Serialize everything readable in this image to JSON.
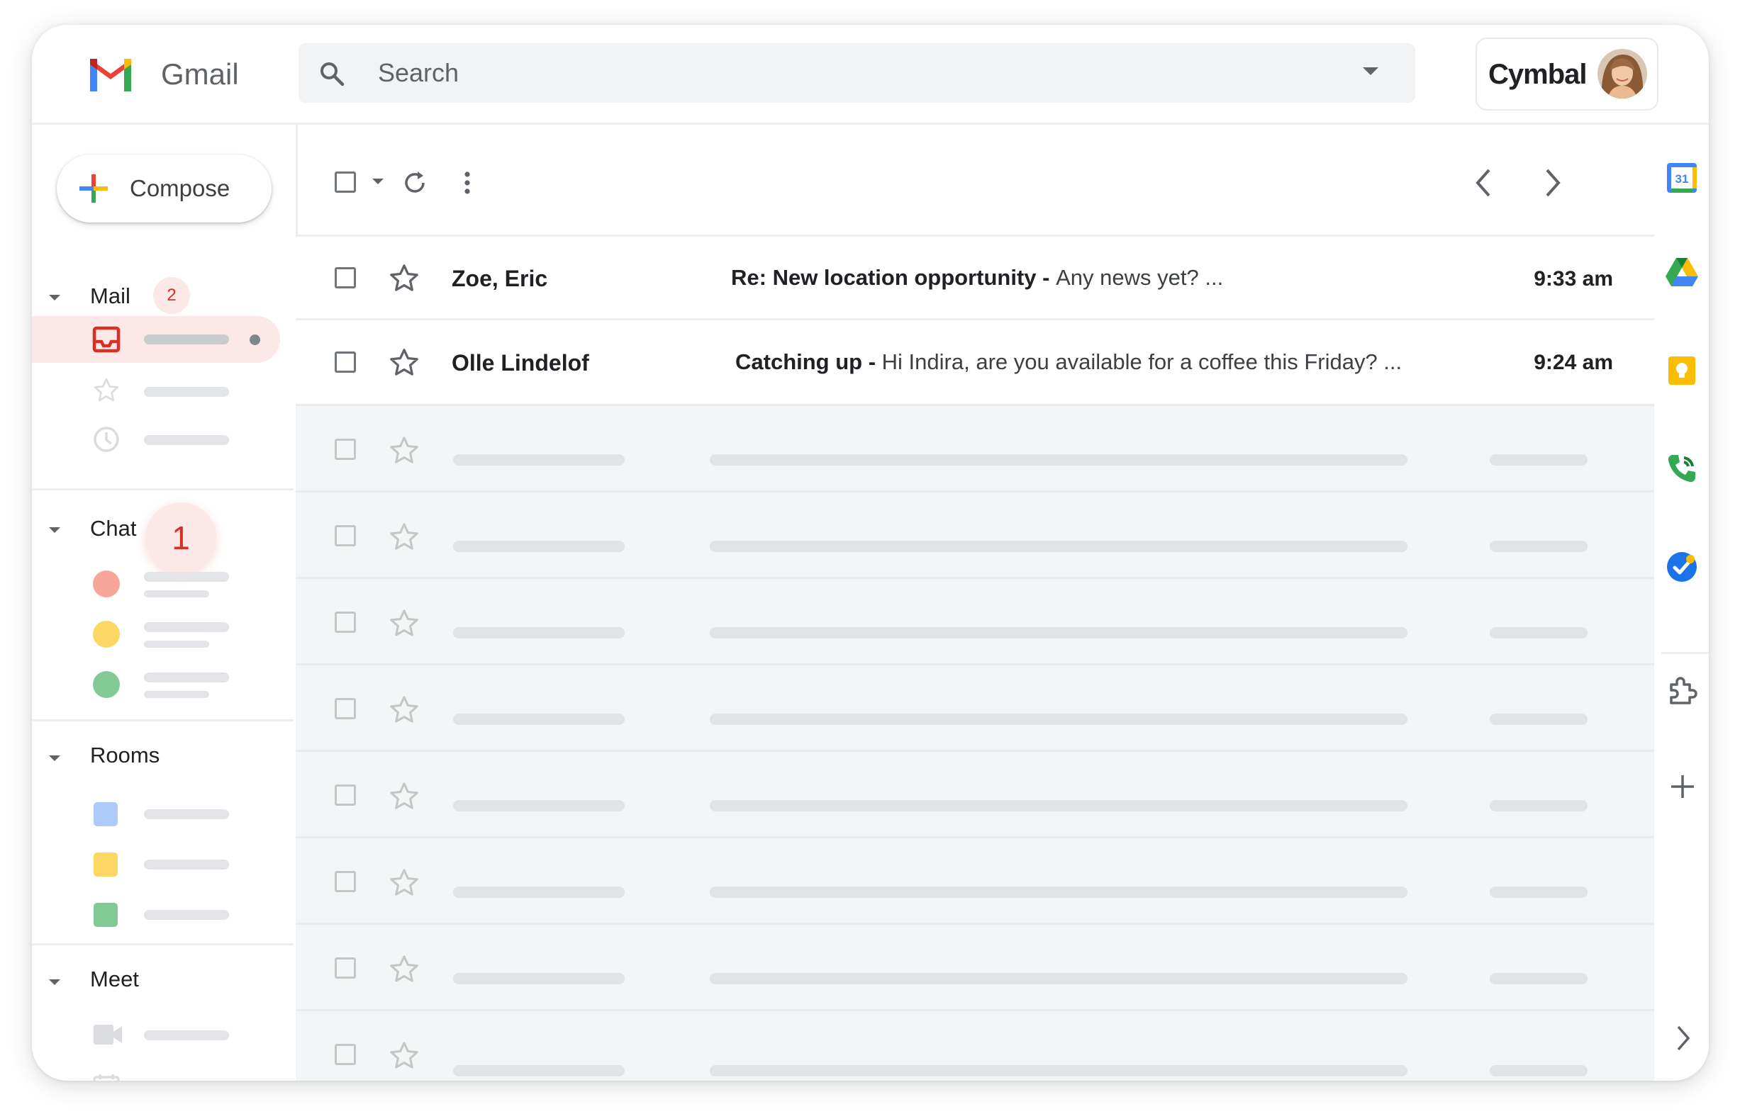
{
  "app": {
    "name": "Gmail",
    "brand": "Cymbal"
  },
  "search": {
    "placeholder": "Search"
  },
  "compose": {
    "label": "Compose"
  },
  "sections": {
    "mail": {
      "title": "Mail",
      "badge": "2"
    },
    "chat": {
      "title": "Chat",
      "badge": "1"
    },
    "rooms": {
      "title": "Rooms"
    },
    "meet": {
      "title": "Meet"
    }
  },
  "emails": [
    {
      "sender": "Zoe, Eric",
      "subject": "Re: New location opportunity",
      "separator": " - ",
      "snippet": "Any news yet? ...",
      "time": "9:33 am"
    },
    {
      "sender": "Olle Lindelof",
      "subject": "Catching up",
      "separator": " - ",
      "snippet": "Hi Indira, are you available for a coffee this Friday? ...",
      "time": "9:24 am"
    }
  ],
  "colors": {
    "accent_red": "#d93025",
    "active_bg": "#fce8e6",
    "chat_dots": [
      "#f7a59b",
      "#fdd663",
      "#81c995"
    ],
    "room_squares": [
      "#aecbfa",
      "#fdd663",
      "#81c995"
    ]
  },
  "icons": {
    "rail": [
      "google-calendar-icon",
      "google-drive-icon",
      "google-keep-icon",
      "google-voice-icon",
      "google-tasks-icon",
      "add-ons-puzzle-icon",
      "add-icon",
      "expand-chevron-icon"
    ]
  },
  "calendar_day": "31"
}
